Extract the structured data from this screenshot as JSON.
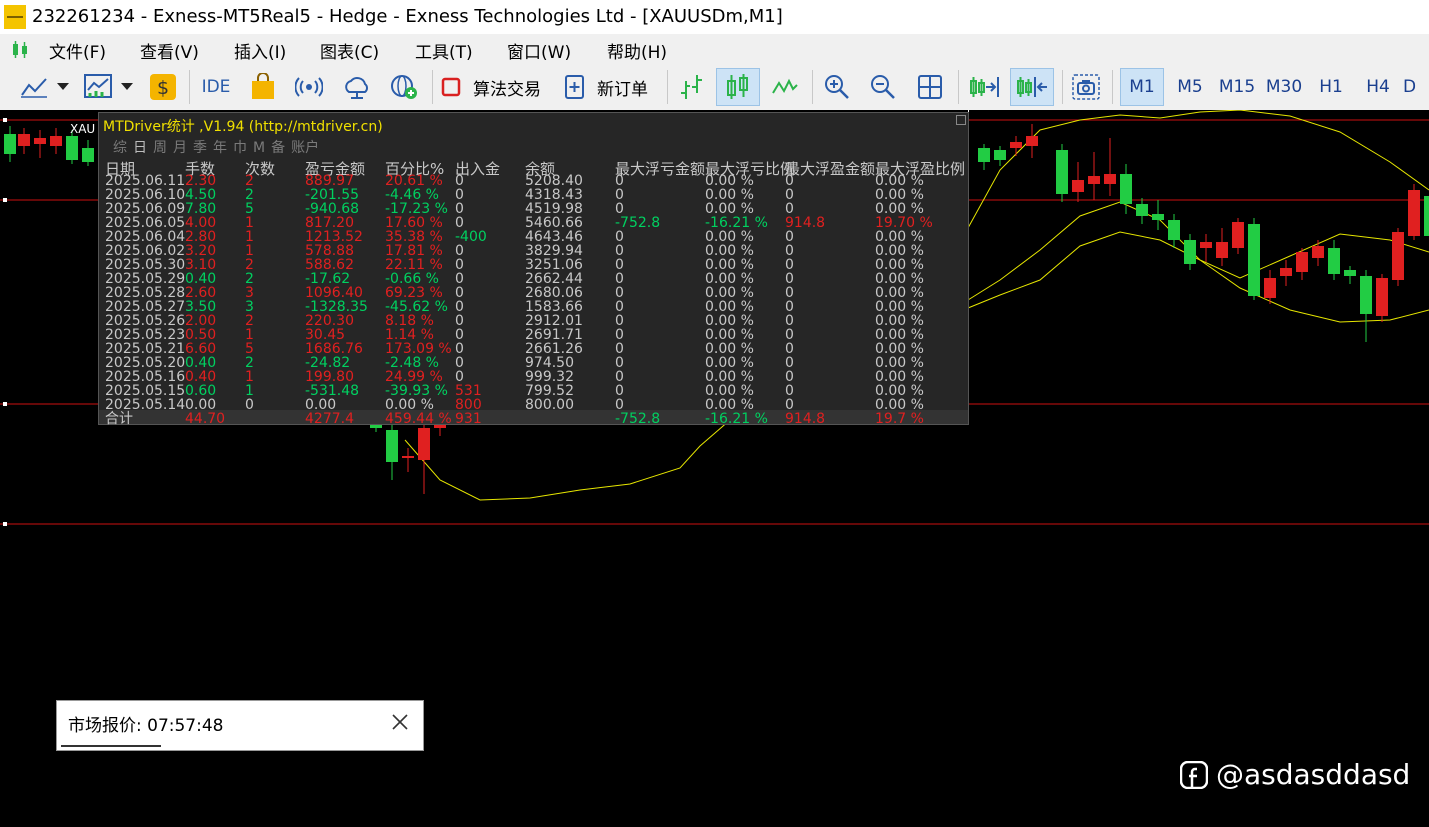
{
  "window": {
    "title": "232261234 - Exness-MT5Real5 - Hedge - Exness Technologies Ltd - [XAUUSDm,M1]"
  },
  "menu": [
    "文件(F)",
    "查看(V)",
    "插入(I)",
    "图表(C)",
    "工具(T)",
    "窗口(W)",
    "帮助(H)"
  ],
  "toolbar": {
    "ide": "IDE",
    "algo_trading": "算法交易",
    "new_order": "新订单",
    "timeframes": [
      "M1",
      "M5",
      "M15",
      "M30",
      "H1",
      "H4",
      "D"
    ],
    "active_timeframe": "M1"
  },
  "chart": {
    "symbol_label": "XAU"
  },
  "stats_panel": {
    "title": "MTDriver统计 ,V1.94 (http://mtdriver.cn)",
    "tabs": [
      "综",
      "日",
      "周",
      "月",
      "季",
      "年",
      "巾",
      "M",
      "备",
      "账户"
    ],
    "selected_tab": "日",
    "headers": [
      "日期",
      "手数",
      "次数",
      "盈亏金额",
      "百分比%",
      "出入金",
      "余额",
      "最大浮亏金额",
      "最大浮亏比例",
      "最大浮盈金额",
      "最大浮盈比例"
    ],
    "rows": [
      {
        "date": "2025.06.11",
        "lots": "2.30",
        "count": "2",
        "pnl": "889.97",
        "pct": "20.61 %",
        "io": "0",
        "bal": "5208.40",
        "mfl": "0",
        "mflp": "0.00 %",
        "mfp": "0",
        "mfpp": "0.00 %",
        "c": "r"
      },
      {
        "date": "2025.06.10",
        "lots": "4.50",
        "count": "2",
        "pnl": "-201.55",
        "pct": "-4.46 %",
        "io": "0",
        "bal": "4318.43",
        "mfl": "0",
        "mflp": "0.00 %",
        "mfp": "0",
        "mfpp": "0.00 %",
        "c": "g"
      },
      {
        "date": "2025.06.09",
        "lots": "7.80",
        "count": "5",
        "pnl": "-940.68",
        "pct": "-17.23 %",
        "io": "0",
        "bal": "4519.98",
        "mfl": "0",
        "mflp": "0.00 %",
        "mfp": "0",
        "mfpp": "0.00 %",
        "c": "g"
      },
      {
        "date": "2025.06.05",
        "lots": "4.00",
        "count": "1",
        "pnl": "817.20",
        "pct": "17.60 %",
        "io": "0",
        "bal": "5460.66",
        "mfl": "-752.8",
        "mflp": "-16.21 %",
        "mfp": "914.8",
        "mfpp": "19.70 %",
        "c": "r"
      },
      {
        "date": "2025.06.04",
        "lots": "2.80",
        "count": "1",
        "pnl": "1213.52",
        "pct": "35.38 %",
        "io": "-400",
        "bal": "4643.46",
        "mfl": "0",
        "mflp": "0.00 %",
        "mfp": "0",
        "mfpp": "0.00 %",
        "c": "r"
      },
      {
        "date": "2025.06.02",
        "lots": "3.20",
        "count": "1",
        "pnl": "578.88",
        "pct": "17.81 %",
        "io": "0",
        "bal": "3829.94",
        "mfl": "0",
        "mflp": "0.00 %",
        "mfp": "0",
        "mfpp": "0.00 %",
        "c": "r"
      },
      {
        "date": "2025.05.30",
        "lots": "3.10",
        "count": "2",
        "pnl": "588.62",
        "pct": "22.11 %",
        "io": "0",
        "bal": "3251.06",
        "mfl": "0",
        "mflp": "0.00 %",
        "mfp": "0",
        "mfpp": "0.00 %",
        "c": "r"
      },
      {
        "date": "2025.05.29",
        "lots": "0.40",
        "count": "2",
        "pnl": "-17.62",
        "pct": "-0.66 %",
        "io": "0",
        "bal": "2662.44",
        "mfl": "0",
        "mflp": "0.00 %",
        "mfp": "0",
        "mfpp": "0.00 %",
        "c": "g"
      },
      {
        "date": "2025.05.28",
        "lots": "2.60",
        "count": "3",
        "pnl": "1096.40",
        "pct": "69.23 %",
        "io": "0",
        "bal": "2680.06",
        "mfl": "0",
        "mflp": "0.00 %",
        "mfp": "0",
        "mfpp": "0.00 %",
        "c": "r"
      },
      {
        "date": "2025.05.27",
        "lots": "3.50",
        "count": "3",
        "pnl": "-1328.35",
        "pct": "-45.62 %",
        "io": "0",
        "bal": "1583.66",
        "mfl": "0",
        "mflp": "0.00 %",
        "mfp": "0",
        "mfpp": "0.00 %",
        "c": "g"
      },
      {
        "date": "2025.05.26",
        "lots": "2.00",
        "count": "2",
        "pnl": "220.30",
        "pct": "8.18 %",
        "io": "0",
        "bal": "2912.01",
        "mfl": "0",
        "mflp": "0.00 %",
        "mfp": "0",
        "mfpp": "0.00 %",
        "c": "r"
      },
      {
        "date": "2025.05.23",
        "lots": "0.50",
        "count": "1",
        "pnl": "30.45",
        "pct": "1.14 %",
        "io": "0",
        "bal": "2691.71",
        "mfl": "0",
        "mflp": "0.00 %",
        "mfp": "0",
        "mfpp": "0.00 %",
        "c": "r"
      },
      {
        "date": "2025.05.21",
        "lots": "6.60",
        "count": "5",
        "pnl": "1686.76",
        "pct": "173.09 %",
        "io": "0",
        "bal": "2661.26",
        "mfl": "0",
        "mflp": "0.00 %",
        "mfp": "0",
        "mfpp": "0.00 %",
        "c": "r"
      },
      {
        "date": "2025.05.20",
        "lots": "0.40",
        "count": "2",
        "pnl": "-24.82",
        "pct": "-2.48 %",
        "io": "0",
        "bal": "974.50",
        "mfl": "0",
        "mflp": "0.00 %",
        "mfp": "0",
        "mfpp": "0.00 %",
        "c": "g"
      },
      {
        "date": "2025.05.16",
        "lots": "0.40",
        "count": "1",
        "pnl": "199.80",
        "pct": "24.99 %",
        "io": "0",
        "bal": "999.32",
        "mfl": "0",
        "mflp": "0.00 %",
        "mfp": "0",
        "mfpp": "0.00 %",
        "c": "r"
      },
      {
        "date": "2025.05.15",
        "lots": "0.60",
        "count": "1",
        "pnl": "-531.48",
        "pct": "-39.93 %",
        "io": "531",
        "bal": "799.52",
        "mfl": "0",
        "mflp": "0.00 %",
        "mfp": "0",
        "mfpp": "0.00 %",
        "c": "g"
      },
      {
        "date": "2025.05.14",
        "lots": "0.00",
        "count": "0",
        "pnl": "0.00",
        "pct": "0.00 %",
        "io": "800",
        "bal": "800.00",
        "mfl": "0",
        "mflp": "0.00 %",
        "mfp": "0",
        "mfpp": "0.00 %",
        "c": "w"
      }
    ],
    "total": {
      "label": "合计",
      "lots": "44.70",
      "pnl": "4277.4",
      "pct": "459.44 %",
      "io": "931",
      "mfl": "-752.8",
      "mflp": "-16.21 %",
      "mfp": "914.8",
      "mfpp": "19.7 %"
    }
  },
  "market_watch": {
    "title": "市场报价: 07:57:48"
  },
  "watermark": {
    "text": "@asdasddasd"
  },
  "colors": {
    "bull": "#22cc44",
    "bear": "#e02020",
    "band": "#e6e600",
    "level": "#cc1111"
  }
}
